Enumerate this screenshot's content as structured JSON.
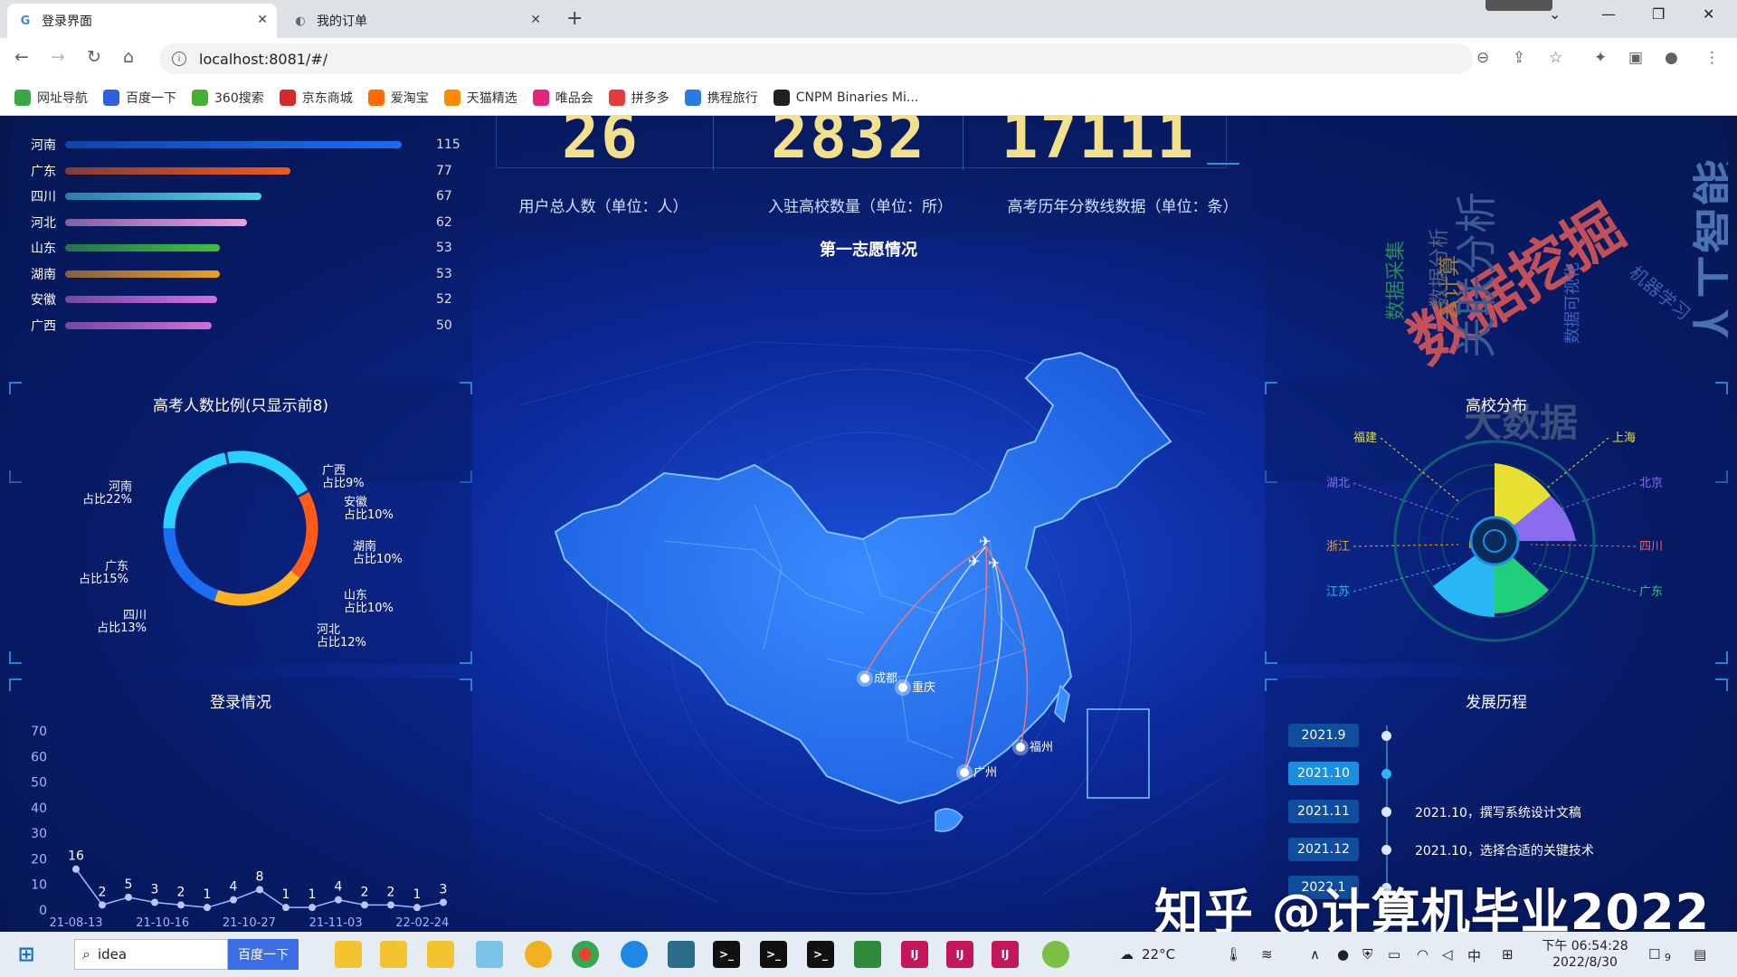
{
  "browser": {
    "tabs": [
      {
        "title": "登录界面",
        "icon": "G"
      },
      {
        "title": "我的订单",
        "icon": "◐"
      }
    ],
    "url": "localhost:8081/#/",
    "bookmarks": [
      {
        "label": "网址导航",
        "color": "#39a845"
      },
      {
        "label": "百度一下",
        "color": "#3060e0"
      },
      {
        "label": "360搜索",
        "color": "#46b130"
      },
      {
        "label": "京东商城",
        "color": "#d62a2a"
      },
      {
        "label": "爱淘宝",
        "color": "#ff6a00"
      },
      {
        "label": "天猫精选",
        "color": "#ff8a00"
      },
      {
        "label": "唯品会",
        "color": "#e4267c"
      },
      {
        "label": "拼多多",
        "color": "#e23c3c"
      },
      {
        "label": "携程旅行",
        "color": "#2a7ae0"
      },
      {
        "label": "CNPM Binaries Mi...",
        "color": "#222222"
      }
    ]
  },
  "dashboard": {
    "province_ranking": [
      {
        "name": "河南",
        "value": 115,
        "color": "#1a6cf0"
      },
      {
        "name": "广东",
        "value": 77,
        "color": "#f05a1a"
      },
      {
        "name": "四川",
        "value": 67,
        "color": "#4fd4e8"
      },
      {
        "name": "河北",
        "value": 62,
        "color": "#e8a0e0"
      },
      {
        "name": "山东",
        "value": 53,
        "color": "#3ec23e"
      },
      {
        "name": "湖南",
        "value": 53,
        "color": "#f0a020"
      },
      {
        "name": "安徽",
        "value": 52,
        "color": "#d070e0"
      },
      {
        "name": "广西",
        "value": 50,
        "color": "#d070d8"
      }
    ],
    "stats": [
      {
        "value": "26",
        "label": "用户总人数（单位：人）"
      },
      {
        "value": "2832",
        "label": "入驻高校数量（单位：所）"
      },
      {
        "value": "17111",
        "label": "高考历年分数线数据（单位：条）"
      }
    ],
    "map_title": "第一志愿情况",
    "map_cities": [
      "成都",
      "重庆",
      "福州",
      "广州"
    ],
    "wordcloud": [
      "数据挖掘",
      "人工智能",
      "大数据",
      "关联分析",
      "云计算",
      "数据采集",
      "数据可视化",
      "机器学习",
      "数据分析"
    ],
    "ratio_title": "高考人数比例(只显示前8)",
    "ratio_labels": [
      {
        "name": "河南",
        "pct": "占比22%"
      },
      {
        "name": "广西",
        "pct": "占比9%"
      },
      {
        "name": "安徽",
        "pct": "占比10%"
      },
      {
        "name": "湖南",
        "pct": "占比10%"
      },
      {
        "name": "山东",
        "pct": "占比10%"
      },
      {
        "name": "河北",
        "pct": "占比12%"
      },
      {
        "name": "四川",
        "pct": "占比13%"
      },
      {
        "name": "广东",
        "pct": "占比15%"
      }
    ],
    "university_title": "高校分布",
    "university_regions": [
      "福建",
      "上海",
      "湖北",
      "北京",
      "浙江",
      "四川",
      "江苏",
      "广东"
    ],
    "login_title": "登录情况",
    "login_chart": {
      "type": "line",
      "y_ticks": [
        "70",
        "60",
        "50",
        "40",
        "30",
        "20",
        "10",
        "0"
      ],
      "ylim": [
        0,
        70
      ],
      "x_ticks": [
        "21-08-13",
        "21-10-16",
        "21-10-27",
        "21-11-03",
        "22-02-24"
      ],
      "values": [
        16,
        2,
        5,
        3,
        2,
        1,
        4,
        8,
        1,
        1,
        4,
        2,
        2,
        1,
        3
      ]
    },
    "history_title": "发展历程",
    "timeline": [
      {
        "date": "2021.9",
        "text": ""
      },
      {
        "date": "2021.10",
        "text": ""
      },
      {
        "date": "2021.11",
        "text": "2021.10，撰写系统设计文稿"
      },
      {
        "date": "2021.12",
        "text": "2021.10，选择合适的关键技术"
      },
      {
        "date": "2022.1",
        "text": ""
      }
    ]
  },
  "watermark": "知乎 @计算机毕业2022",
  "taskbar": {
    "search_value": "idea",
    "search_button": "百度一下",
    "weather": "22°C",
    "ime_mode": "中",
    "time": "下午 06:54:28",
    "date": "2022/8/30",
    "notifications": "9"
  }
}
